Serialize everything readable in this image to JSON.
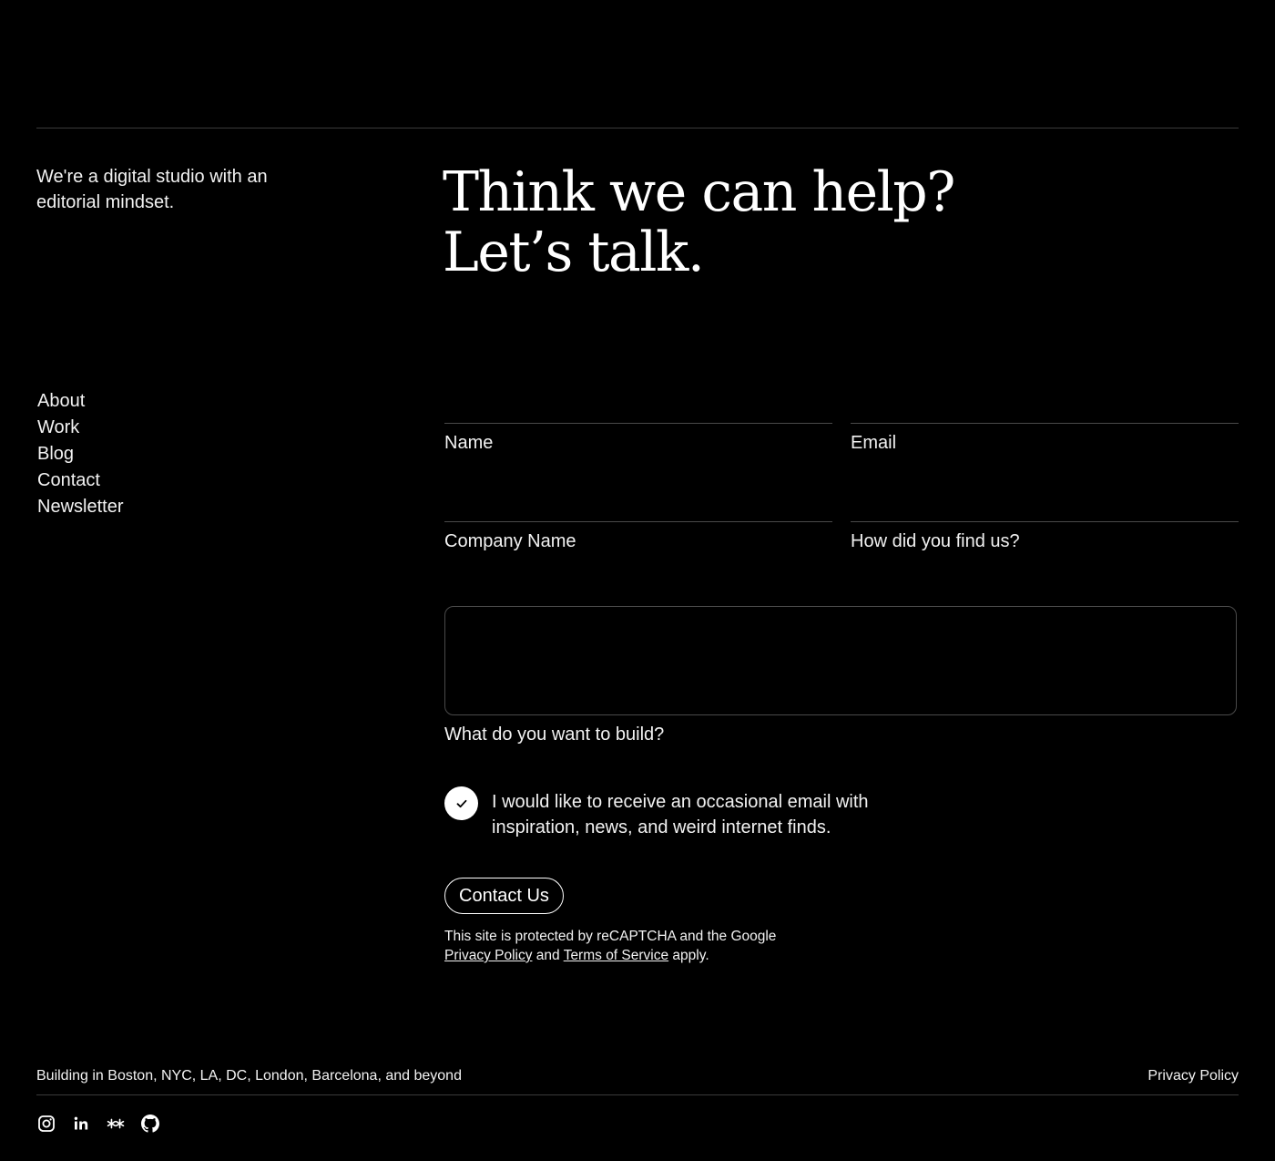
{
  "tagline": "We're a digital studio with an editorial mindset.",
  "headline": {
    "line1": "Think we can help?",
    "line2": "Let’s talk."
  },
  "nav": {
    "items": [
      {
        "label": "About"
      },
      {
        "label": "Work"
      },
      {
        "label": "Blog"
      },
      {
        "label": "Contact"
      },
      {
        "label": "Newsletter"
      }
    ]
  },
  "form": {
    "name_label": "Name",
    "name_value": "",
    "email_label": "Email",
    "email_value": "",
    "company_label": "Company Name",
    "company_value": "",
    "source_label": "How did you find us?",
    "source_value": "",
    "message_label": "What do you want to build?",
    "message_value": "",
    "newsletter_checked": true,
    "newsletter_label": "I would like to receive an occasional email with inspiration, news, and weird internet finds.",
    "submit_label": "Contact Us"
  },
  "recaptcha": {
    "prefix": "This site is protected by reCAPTCHA and the Google",
    "privacy_link": "Privacy Policy",
    "and": "and",
    "terms_link": "Terms of Service",
    "suffix": "apply."
  },
  "footer": {
    "location": "Building in Boston, NYC, LA, DC, London, Barcelona, and beyond",
    "privacy": "Privacy Policy",
    "socials": [
      {
        "icon": "instagram-icon"
      },
      {
        "icon": "linkedin-icon"
      },
      {
        "icon": "asterisks-icon"
      },
      {
        "icon": "github-icon"
      }
    ]
  },
  "colors": {
    "background": "#000000",
    "text": "#ffffff",
    "rule": "#3a3a3a"
  }
}
